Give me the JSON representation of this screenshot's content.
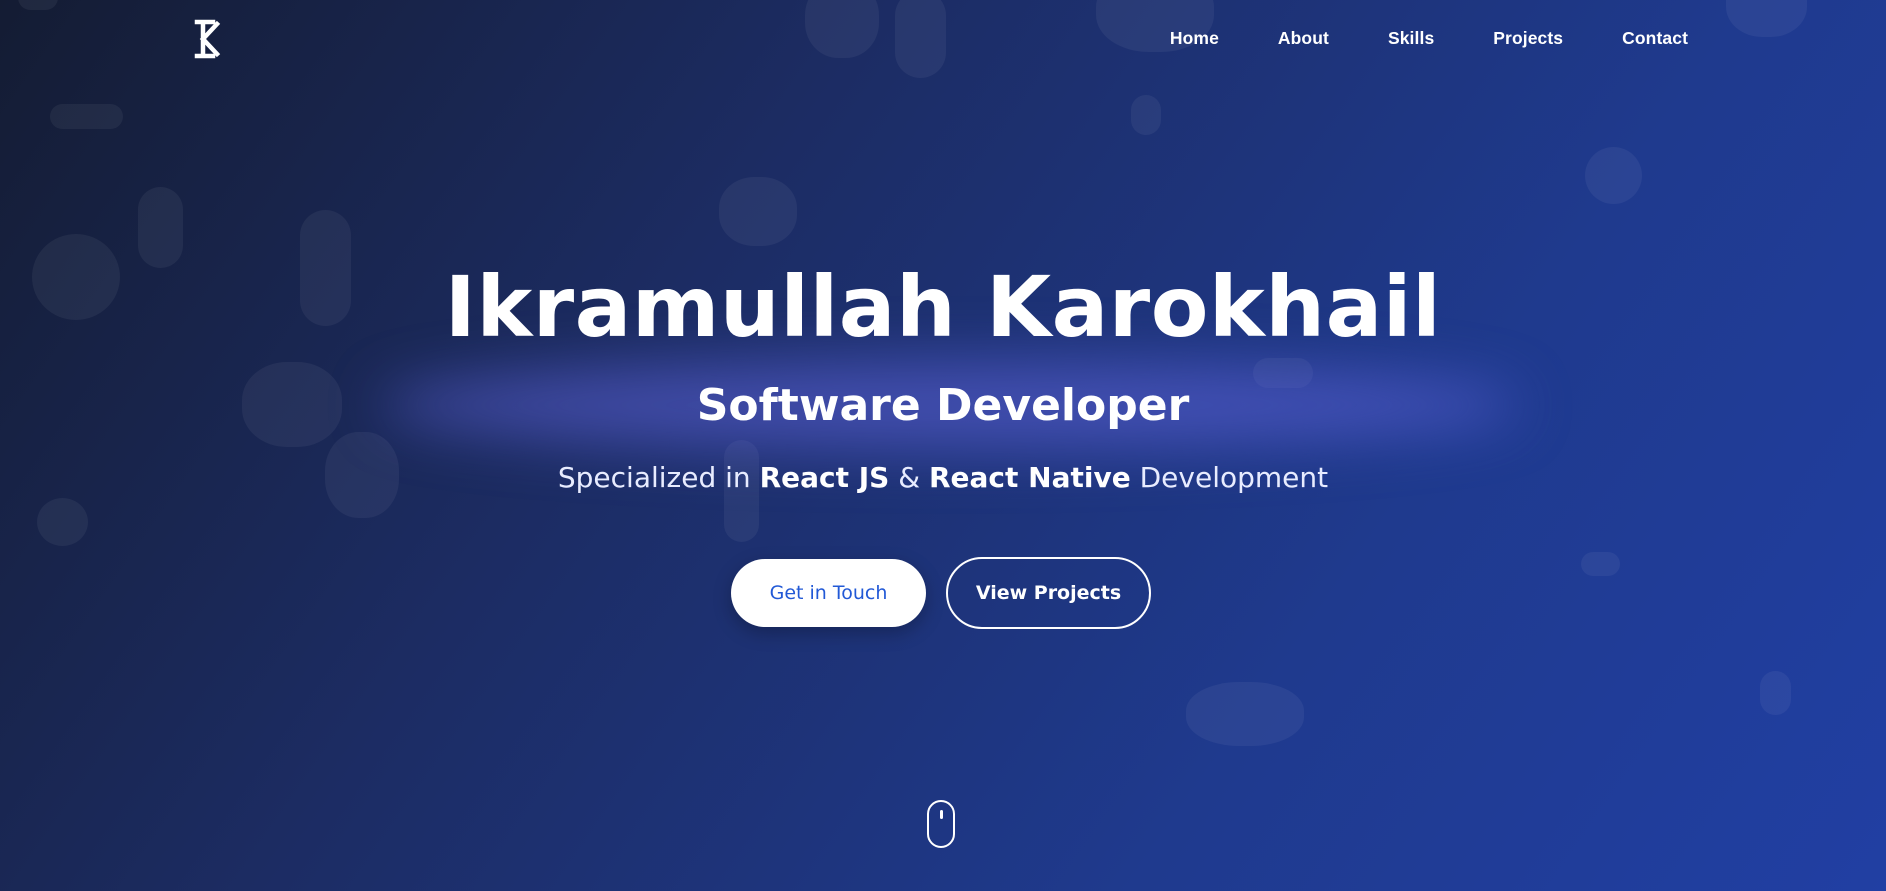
{
  "logo": {
    "icon": "logo-k-icon",
    "monogram": "K"
  },
  "nav": {
    "items": [
      {
        "label": "Home"
      },
      {
        "label": "About"
      },
      {
        "label": "Skills"
      },
      {
        "label": "Projects"
      },
      {
        "label": "Contact"
      }
    ]
  },
  "hero": {
    "name": "Ikramullah Karokhail",
    "title": "Software Developer",
    "tagline": {
      "prefix": "Specialized in ",
      "tech1": "React JS",
      "joiner": " & ",
      "tech2": "React Native",
      "suffix": " Development"
    },
    "primary_button": "Get in Touch",
    "secondary_button": "View Projects"
  },
  "scroll_indicator": {
    "icon": "mouse-scroll-icon"
  },
  "colors": {
    "background_start": "#141c33",
    "background_end": "#213fa3",
    "primary_button_text": "#2259d6",
    "text": "#ffffff"
  }
}
